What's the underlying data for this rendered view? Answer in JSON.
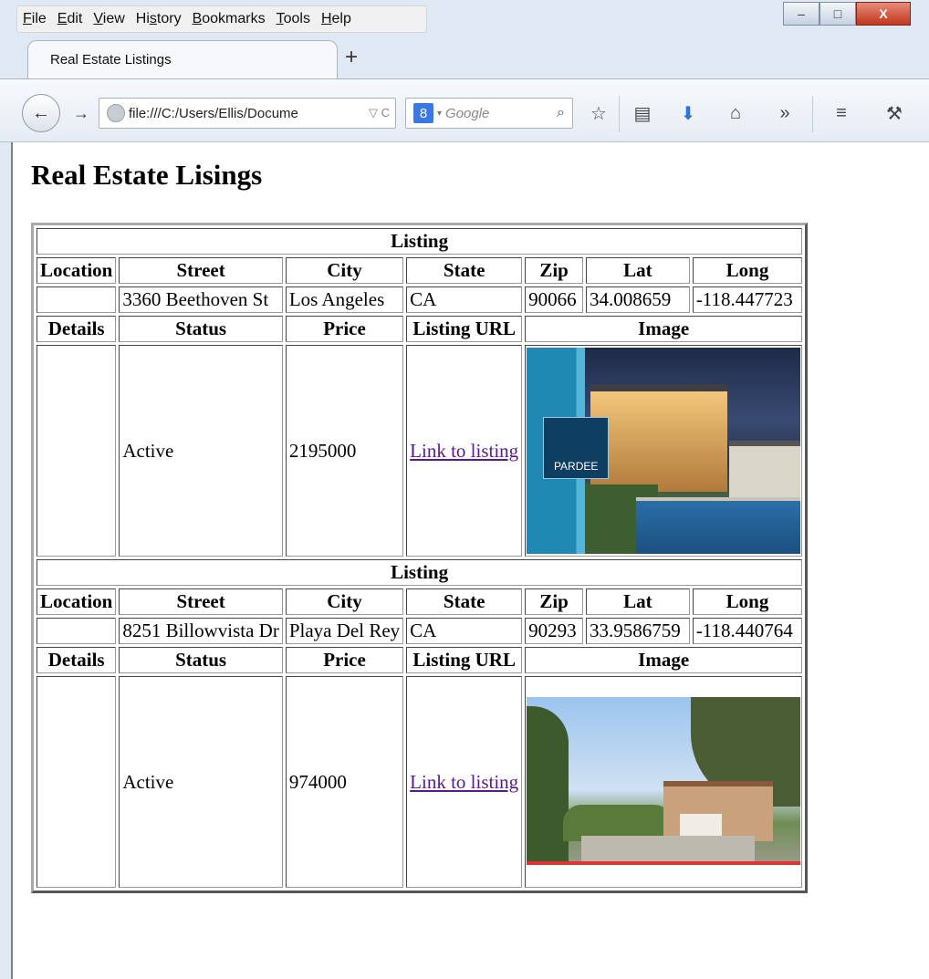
{
  "menu": [
    "File",
    "Edit",
    "View",
    "History",
    "Bookmarks",
    "Tools",
    "Help"
  ],
  "menu_mnemonics": [
    "F",
    "E",
    "V",
    "s",
    "B",
    "T",
    "H"
  ],
  "tab": {
    "title": "Real Estate Listings",
    "new_tab": "+"
  },
  "navbar": {
    "url": "file:///C:/Users/Ellis/Docume",
    "url_icons": "▽ C",
    "search_engine_badge": "8",
    "search_placeholder": "Google"
  },
  "window_controls": {
    "minimize": "–",
    "maximize": "□",
    "close": "X"
  },
  "page": {
    "title": "Real Estate Lisings",
    "headers": {
      "listing": "Listing",
      "location": "Location",
      "street": "Street",
      "city": "City",
      "state": "State",
      "zip": "Zip",
      "lat": "Lat",
      "long": "Long",
      "details": "Details",
      "status": "Status",
      "price": "Price",
      "listing_url": "Listing URL",
      "image": "Image"
    },
    "listings": [
      {
        "street": "3360 Beethoven St",
        "city": "Los Angeles",
        "state": "CA",
        "zip": "90066",
        "lat": "34.008659",
        "long": "-118.447723",
        "status": "Active",
        "price": "2195000",
        "link_text": "Link to listing",
        "image_logo": "PARDEE"
      },
      {
        "street": "8251 Billowvista Dr",
        "city": "Playa Del Rey",
        "state": "CA",
        "zip": "90293",
        "lat": "33.9586759",
        "long": "-118.440764",
        "status": "Active",
        "price": "974000",
        "link_text": "Link to listing"
      }
    ]
  },
  "colors": {
    "link_visited": "#551a8b",
    "chrome_bg": "#dfe8f3",
    "close_button": "#c2351c"
  }
}
